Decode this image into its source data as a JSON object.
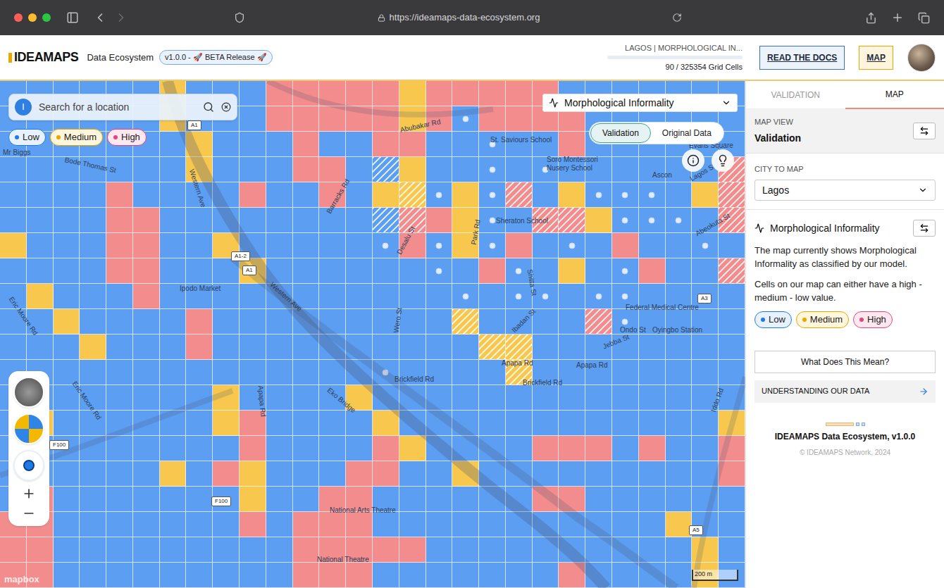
{
  "browser": {
    "url": "https://ideamaps-data-ecosystem.org"
  },
  "header": {
    "logo": "IDEAMAPS",
    "product": "Data Ecosystem",
    "badge": "v1.0.0 - 🚀 BETA Release 🚀",
    "progress": {
      "label": "LAGOS | MORPHOLOGICAL IN...",
      "level": 0.0003,
      "count": "90 / 325354 Grid Cells"
    },
    "buttons": [
      {
        "label": "READ THE DOCS",
        "selected": false
      },
      {
        "label": "MAP",
        "selected": true
      }
    ]
  },
  "map": {
    "search": {
      "badge": "I",
      "placeholder": "Search for a location"
    },
    "legend": [
      {
        "label": "Low",
        "key": "L",
        "color": "#1d7ae6"
      },
      {
        "label": "Medium",
        "key": "M",
        "color": "#e8a800"
      },
      {
        "label": "High",
        "key": "H",
        "color": "#e0457b"
      }
    ],
    "layer": "Morphological Informality",
    "view_toggle": [
      {
        "label": "Validation",
        "selected": true
      },
      {
        "label": "Original Data",
        "selected": false
      }
    ],
    "labels": [
      "Bode Thomas St",
      "Western Ave",
      "Western Ave",
      "Eric Moore Rd",
      "Eric Moore Rd",
      "Apapa Rd",
      "Eko Bridge",
      "Brickfield Rd",
      "Apapa Rd",
      "Brickfield Rd",
      "Apapa Rd",
      "Ipodo Market",
      "Abubakar Rd",
      "St. Saviours School",
      "Soro Montessori",
      "Nusery School",
      "Sheraton School",
      "Federal Medical Centre",
      "Oyingbo Station",
      "National Arts Theatre",
      "National Theatre",
      "Ondo St",
      "Jebba St",
      "Ibadan St",
      "Lagos St",
      "Abeokuta St",
      "Iddo Rd",
      "Barracks Rd",
      "Desalu St",
      "Wero St",
      "Park Rd",
      "Evans Square",
      "Ascon",
      "Mr Biggs",
      "Shitta St"
    ],
    "shields": [
      "A1",
      "A1-2",
      "A1",
      "F100",
      "F100",
      "A3",
      "A5"
    ],
    "scale": "200 m",
    "attribution": "mapbox",
    "grid": [
      "LLLLLLMLLLHHHHHMHHHHHLLLLLLL",
      "LLLLLLMLLLHHHHHMH*HHHHLLLLLL",
      "LLLLLLLMLLLHLLHHLL*LLHLLLLLL",
      "LLLLLLLMLLLHHLlMLL*L*LLLLLLh",
      "LLLLHLLLLHLLHLMm*M*hLM***LMh",
      "LLLLHHLLLLLLLLlhHM*LhhM***Lh",
      "MLLLHHLLMLLLLL*H*M*HL*LHLL*L",
      "LLLLHHLLLMLLLLLL*LH*LML*HLLh",
      "LMLLLHLLLLLLLLLLL*L**L**LLLL",
      "LLMLLLLHLLLLLLLLLmLLLLh*LLLL",
      "LLLMLLLHLLLLLLLLLLmmLLLLLLLL",
      "LLLLLLLLLLLLLL*LLLLmLLLLLLLL",
      "LLLLLLLLMLLLLMLLLLLLLLLLLLLL",
      "LMLLLLLLMHLLLLMLLLLLLLLLLLLM",
      "LLLLLLLLLHLLLLHMLLLLHHHLHLLH",
      "LLLLLLMLHMLLLHHLLMLLLLLLLLLH",
      "LHLLLLLLLMLLHHLLLLLLHHLLLLLL",
      "HHLLLLLLLHLHHHLLLLLLLLLLLMLL",
      "HHLLLLLLLLLHHHHHLLLLLLLLLLML",
      "HHLLLLLLLLLHHHLLLLLLLHLLLLML"
    ]
  },
  "sidebar": {
    "tabs": [
      {
        "label": "VALIDATION",
        "selected": false
      },
      {
        "label": "MAP",
        "selected": true
      }
    ],
    "map_view": {
      "label": "MAP VIEW",
      "value": "Validation"
    },
    "city": {
      "label": "CITY TO MAP",
      "value": "Lagos"
    },
    "layer": {
      "title": "Morphological Informality",
      "paragraphs": [
        "The map currently shows Morphological Informality as classified by our model.",
        "Cells on our map can either have a high - medium - low value."
      ]
    },
    "button": "What Does This Mean?",
    "link": "UNDERSTANDING OUR DATA",
    "footer": {
      "title": "IDEAMAPS Data Ecosystem, v1.0.0",
      "copyright": "© IDEAMAPS Network, 2024"
    }
  }
}
